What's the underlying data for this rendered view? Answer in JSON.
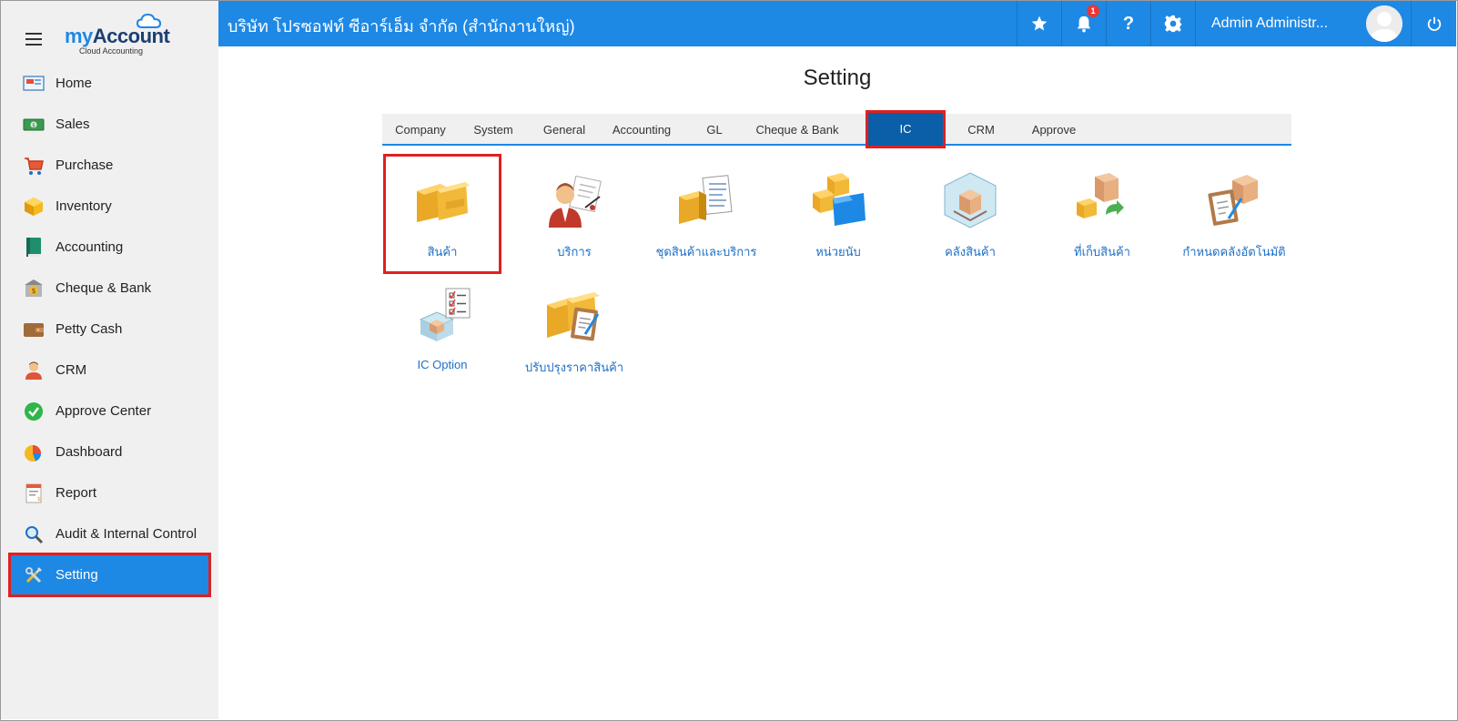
{
  "sidebar": {
    "brand": {
      "name_my": "my",
      "name_account": "Account",
      "subtitle": "Cloud Accounting"
    },
    "items": [
      {
        "label": "Home",
        "icon": "home-icon"
      },
      {
        "label": "Sales",
        "icon": "money-icon"
      },
      {
        "label": "Purchase",
        "icon": "cart-icon"
      },
      {
        "label": "Inventory",
        "icon": "box-icon"
      },
      {
        "label": "Accounting",
        "icon": "ledger-book-icon"
      },
      {
        "label": "Cheque & Bank",
        "icon": "bank-icon"
      },
      {
        "label": "Petty Cash",
        "icon": "wallet-icon"
      },
      {
        "label": "CRM",
        "icon": "customer-icon"
      },
      {
        "label": "Approve Center",
        "icon": "check-circle-icon"
      },
      {
        "label": "Dashboard",
        "icon": "pie-chart-icon"
      },
      {
        "label": "Report",
        "icon": "report-icon"
      },
      {
        "label": "Audit & Internal Control",
        "icon": "magnifier-icon"
      },
      {
        "label": "Setting",
        "icon": "tools-icon",
        "active": true
      }
    ]
  },
  "header": {
    "company": "บริษัท โปรซอฟท์ ซีอาร์เอ็ม จำกัด (สำนักงานใหญ่)",
    "notification_count": "1",
    "help_label": "?",
    "user_name": "Admin Administr..."
  },
  "main": {
    "title": "Setting",
    "tabs": [
      {
        "label": "Company"
      },
      {
        "label": "System"
      },
      {
        "label": "General"
      },
      {
        "label": "Accounting"
      },
      {
        "label": "GL"
      },
      {
        "label": "Cheque & Bank"
      },
      {
        "label": "IC",
        "active": true
      },
      {
        "label": "CRM"
      },
      {
        "label": "Approve"
      }
    ],
    "tiles": [
      {
        "label": "สินค้า",
        "icon": "product-boxes-icon",
        "highlighted": true
      },
      {
        "label": "บริการ",
        "icon": "service-person-icon"
      },
      {
        "label": "ชุดสินค้าและบริการ",
        "icon": "product-set-icon"
      },
      {
        "label": "หน่วยนับ",
        "icon": "unit-folder-icon"
      },
      {
        "label": "คลังสินค้า",
        "icon": "warehouse-icon"
      },
      {
        "label": "ที่เก็บสินค้า",
        "icon": "storage-location-icon"
      },
      {
        "label": "กำหนดคลังอัตโนมัติ",
        "icon": "auto-warehouse-icon"
      },
      {
        "label": "IC Option",
        "icon": "ic-option-checklist-icon"
      },
      {
        "label": "ปรับปรุงราคาสินค้า",
        "icon": "price-adjust-clipboard-icon"
      }
    ]
  },
  "colors": {
    "header_bg": "#1e88e5",
    "active_tab_bg": "#0b5ea8",
    "highlight_border": "#e02020",
    "tile_label": "#1e6fc5"
  }
}
